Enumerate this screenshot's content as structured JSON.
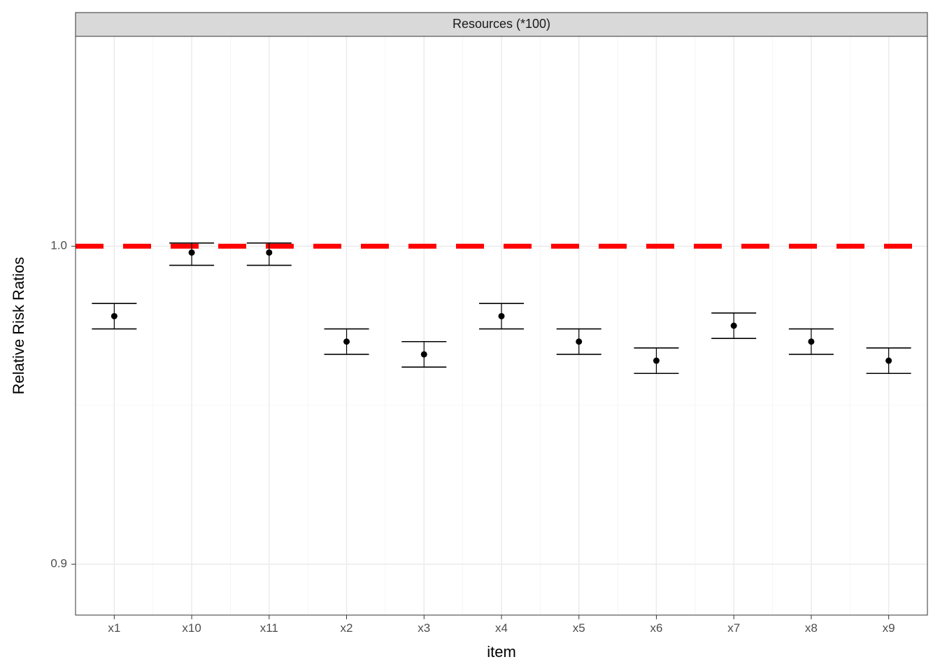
{
  "chart_data": {
    "type": "scatter",
    "facet_label": "Resources (*100)",
    "reference_line": 1.0,
    "xlabel": "item",
    "ylabel": "Relative Risk Ratios",
    "y_ticks": [
      0.9,
      1.0
    ],
    "y_tick_labels": [
      "0.9",
      "1.0"
    ],
    "ylim": [
      0.884,
      1.066
    ],
    "categories": [
      "x1",
      "x10",
      "x11",
      "x2",
      "x3",
      "x4",
      "x5",
      "x6",
      "x7",
      "x8",
      "x9"
    ],
    "series": [
      {
        "name": "Relative Risk Ratios",
        "points": [
          {
            "x": "x1",
            "y": 0.978,
            "lo": 0.974,
            "hi": 0.982
          },
          {
            "x": "x10",
            "y": 0.998,
            "lo": 0.994,
            "hi": 1.001
          },
          {
            "x": "x11",
            "y": 0.998,
            "lo": 0.994,
            "hi": 1.001
          },
          {
            "x": "x2",
            "y": 0.97,
            "lo": 0.966,
            "hi": 0.974
          },
          {
            "x": "x3",
            "y": 0.966,
            "lo": 0.962,
            "hi": 0.97
          },
          {
            "x": "x4",
            "y": 0.978,
            "lo": 0.974,
            "hi": 0.982
          },
          {
            "x": "x5",
            "y": 0.97,
            "lo": 0.966,
            "hi": 0.974
          },
          {
            "x": "x6",
            "y": 0.964,
            "lo": 0.96,
            "hi": 0.968
          },
          {
            "x": "x7",
            "y": 0.975,
            "lo": 0.971,
            "hi": 0.979
          },
          {
            "x": "x8",
            "y": 0.97,
            "lo": 0.966,
            "hi": 0.974
          },
          {
            "x": "x9",
            "y": 0.964,
            "lo": 0.96,
            "hi": 0.968
          }
        ]
      }
    ]
  }
}
